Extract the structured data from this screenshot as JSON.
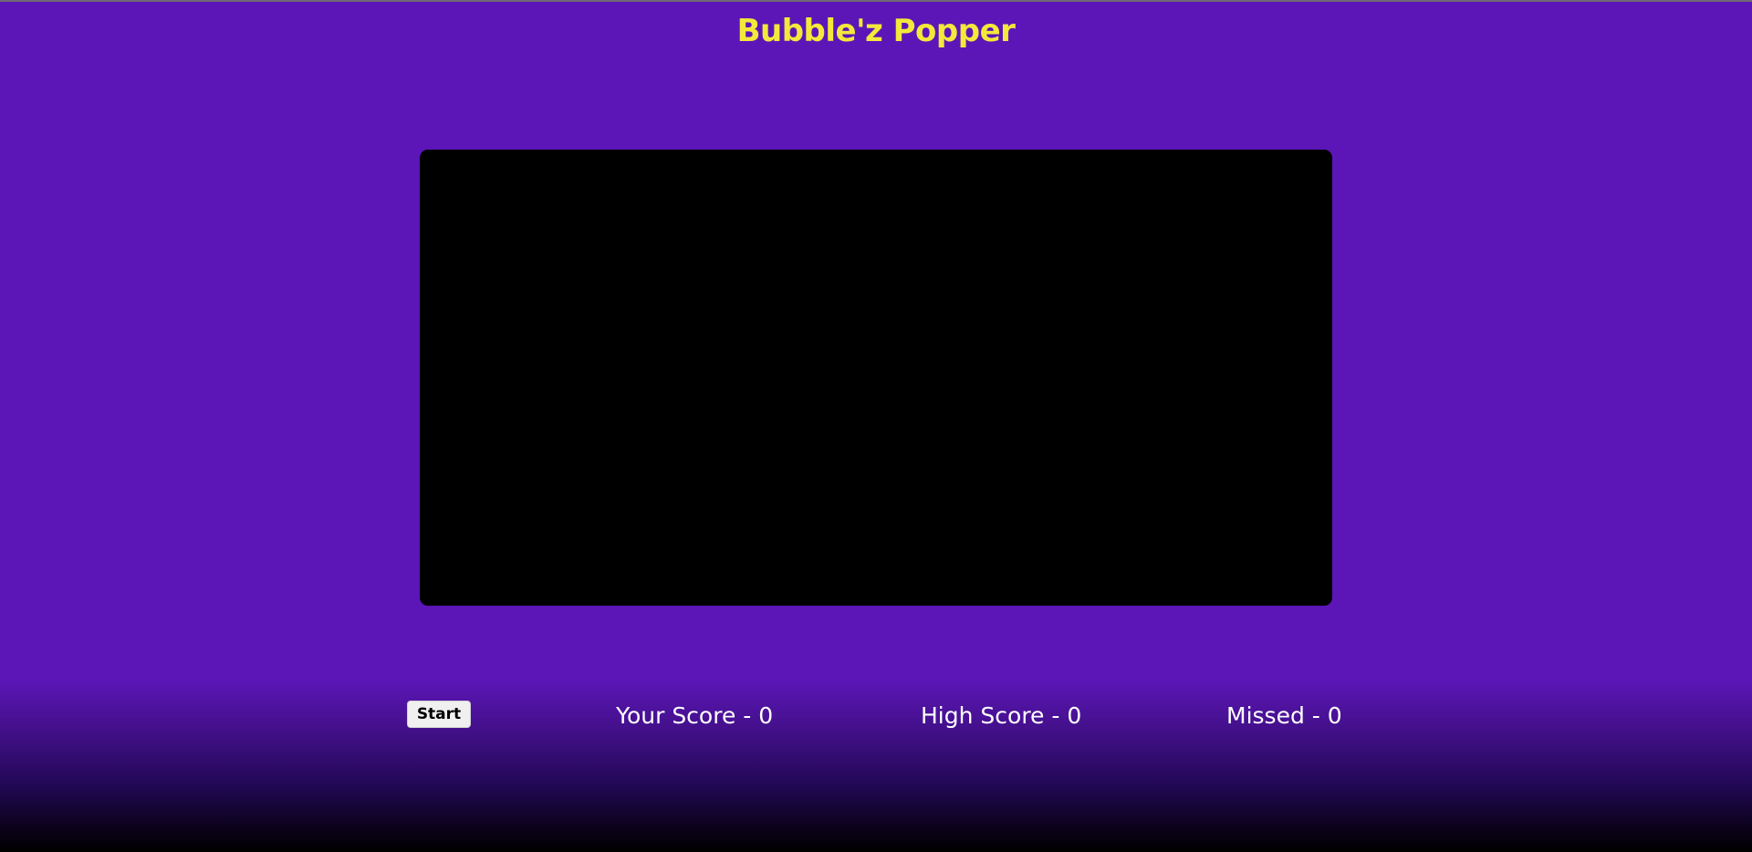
{
  "header": {
    "title": "Bubble'z Popper"
  },
  "controls": {
    "start_label": "Start"
  },
  "stats": {
    "score_label": "Your Score - 0",
    "high_score_label": "High Score - 0",
    "missed_label": "Missed - 0"
  },
  "colors": {
    "background": "#5c16b8",
    "title": "#f2e93a",
    "game_area": "#000000",
    "stat_text": "#ffffff"
  }
}
